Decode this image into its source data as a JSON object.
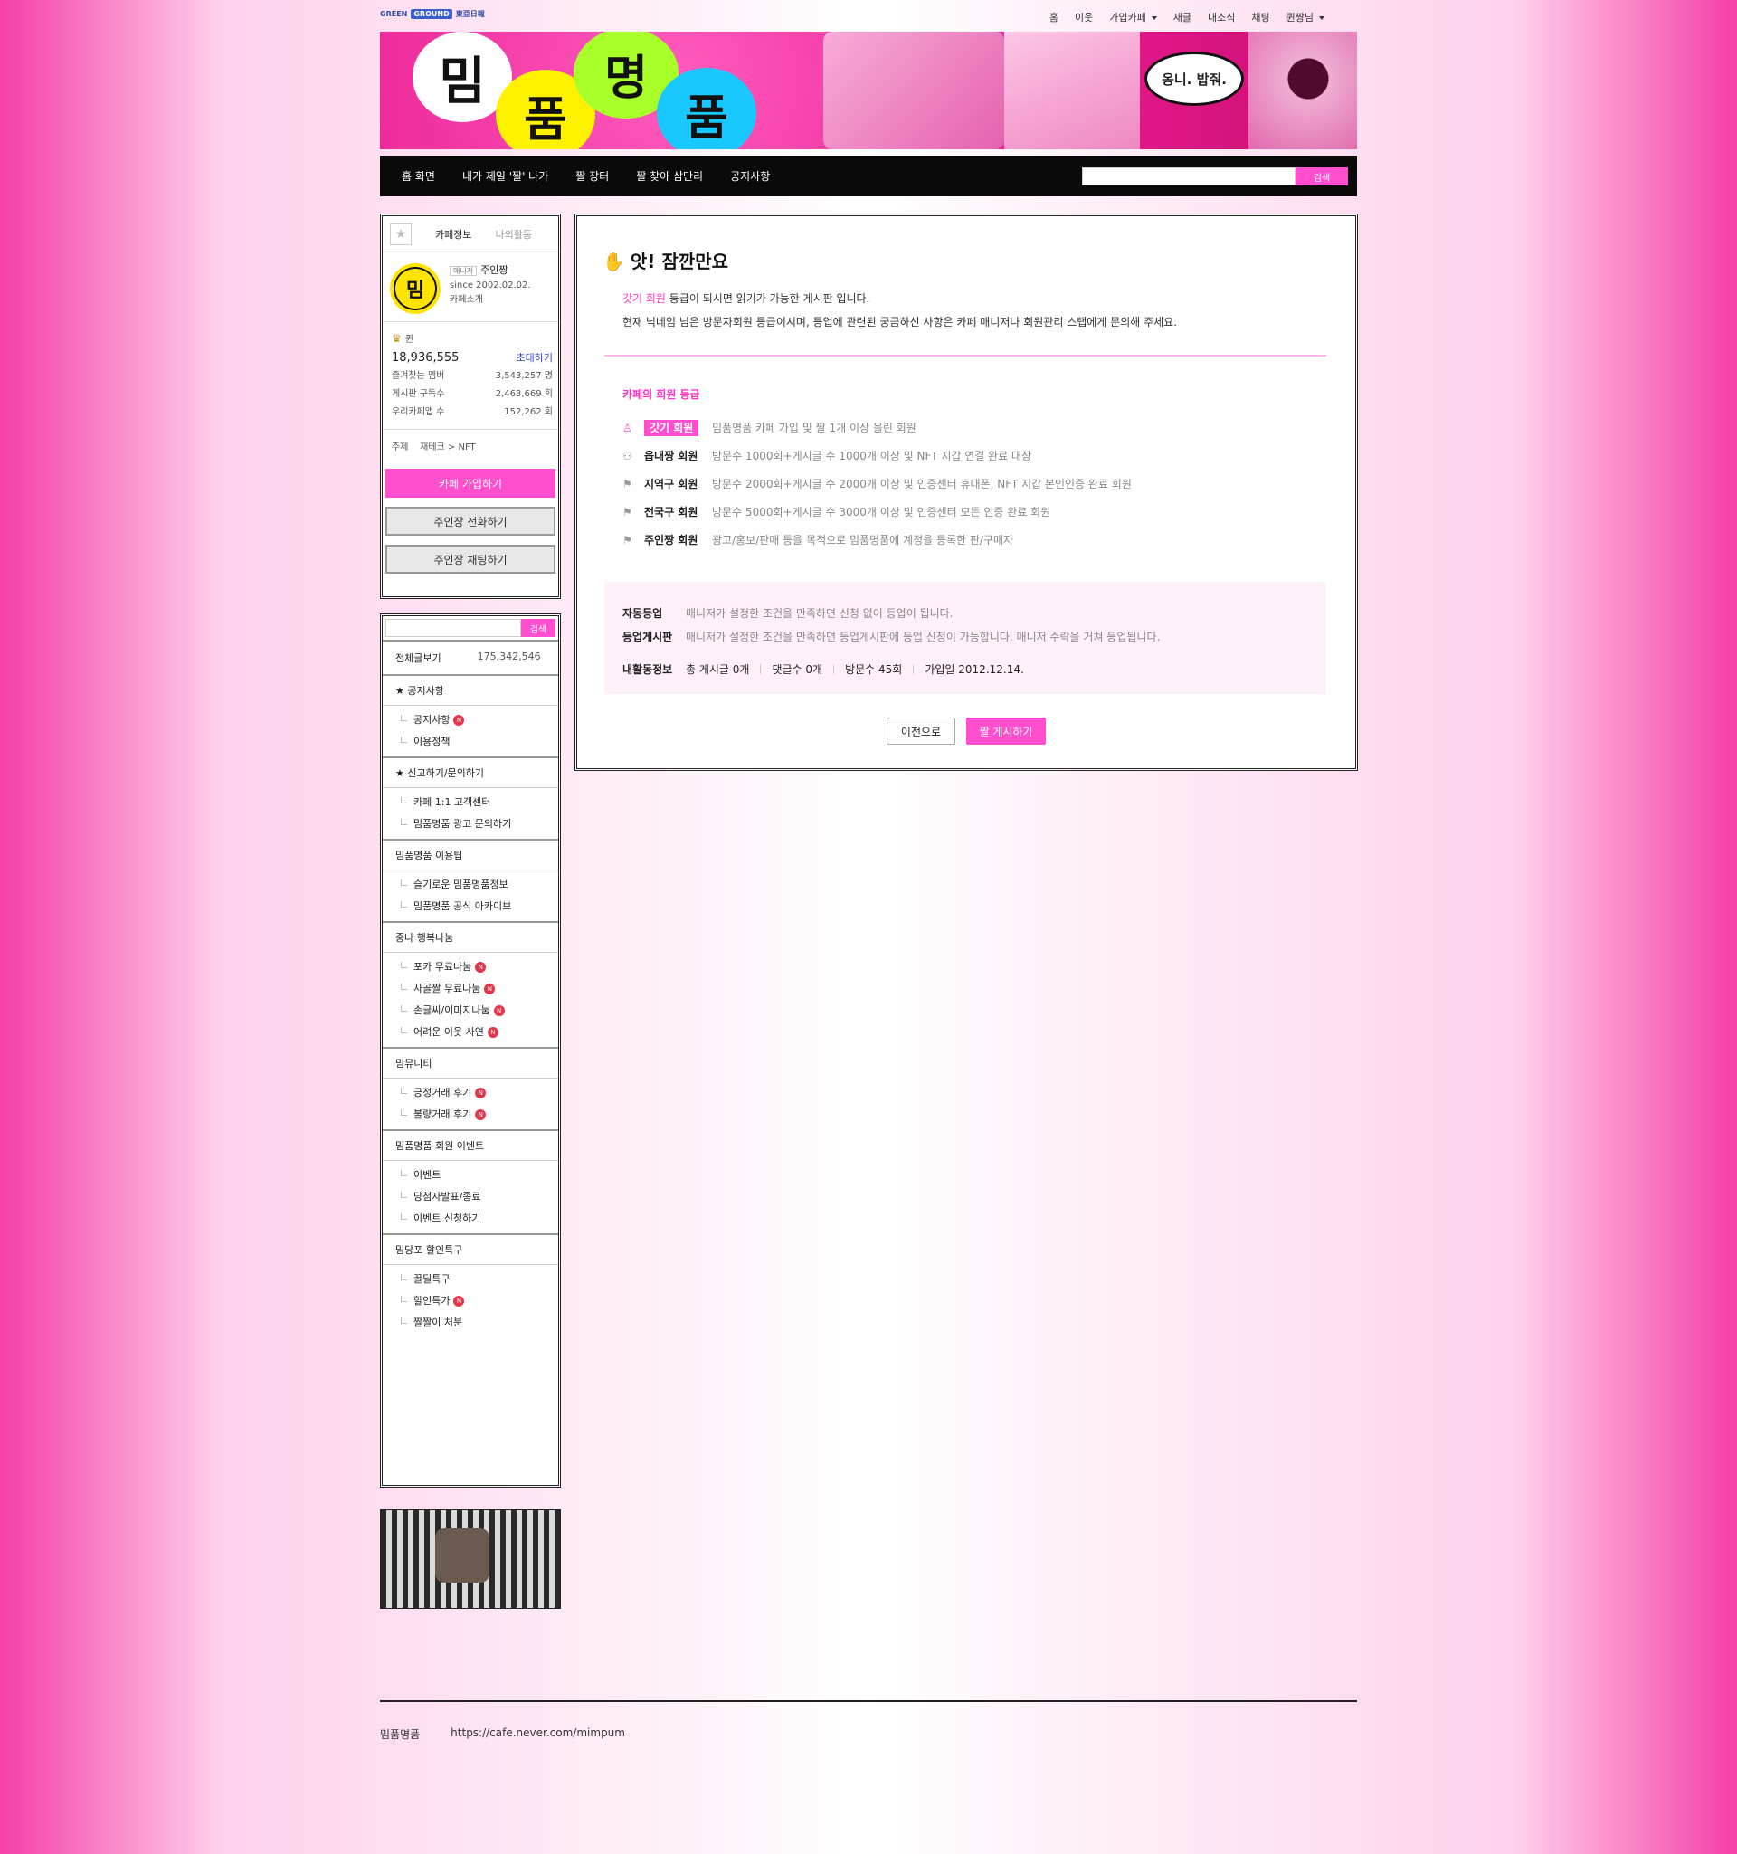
{
  "top_bar": {
    "logos": [
      "GREEN",
      "GROUND",
      "東亞日報"
    ],
    "links": [
      "홈",
      "이웃",
      "가입카페",
      "새글",
      "내소식",
      "채팅",
      "퀸짱님"
    ]
  },
  "banner": {
    "bursts": [
      "밈",
      "품",
      "명",
      "품"
    ],
    "speech": "옹니. 밥줘."
  },
  "nav": {
    "items": [
      "홈 화면",
      "내가 제일 '짤' 나가",
      "짤 장터",
      "짤 찾아 삼만리",
      "공지사항"
    ],
    "search_button": "검색"
  },
  "cafe_info": {
    "tab_info": "카페정보",
    "tab_activity": "나의활동",
    "manager_badge": "매니저",
    "manager_name": "주인짱",
    "since": "since 2002.02.02.",
    "intro": "카페소개",
    "logo_text": "밈",
    "rank": "퀸",
    "members": "18,936,555",
    "invite": "초대하기",
    "stats": [
      {
        "label": "즐겨찾는 멤버",
        "value": "3,543,257 명"
      },
      {
        "label": "게시판 구독수",
        "value": "2,463,669 회"
      },
      {
        "label": "우리카페앱 수",
        "value": "152,262 회"
      }
    ],
    "topic_label": "주제",
    "topic_value": "재테크 > NFT",
    "join_button": "카페 가입하기",
    "call_button": "주인장 전화하기",
    "chat_button": "주인장 채팅하기"
  },
  "menu": {
    "search_button": "검색",
    "total_label": "전체글보기",
    "total_count": "175,342,546",
    "sections": [
      {
        "title": "★ 공지사항",
        "items": [
          {
            "label": "공지사항",
            "new": true
          },
          {
            "label": "이용정책",
            "new": false
          }
        ]
      },
      {
        "title": "★ 신고하기/문의하기",
        "items": [
          {
            "label": "카페 1:1 고객센터",
            "new": false
          },
          {
            "label": "밈품명품 광고 문의하기",
            "new": false
          }
        ]
      },
      {
        "title": "밈품명품 이용팁",
        "items": [
          {
            "label": "슬기로운 밈품명품정보",
            "new": false
          },
          {
            "label": "밈품명품 공식 아카이브",
            "new": false
          }
        ]
      },
      {
        "title": "중나 행복나눔",
        "items": [
          {
            "label": "포카 무료나눔",
            "new": true
          },
          {
            "label": "사골짤 무료나눔",
            "new": true
          },
          {
            "label": "손글씨/이미지나눔",
            "new": true
          },
          {
            "label": "어려운 이웃 사연",
            "new": true
          }
        ]
      },
      {
        "title": "밈뮤니티",
        "items": [
          {
            "label": "긍정거래 후기",
            "new": true
          },
          {
            "label": "불량거래 후기",
            "new": true
          }
        ]
      },
      {
        "title": "밈품명품 회원 이벤트",
        "items": [
          {
            "label": "이벤트",
            "new": false
          },
          {
            "label": "당첨자발표/종료",
            "new": false
          },
          {
            "label": "이벤트 신청하기",
            "new": false
          }
        ]
      },
      {
        "title": "밈당포 할인특구",
        "items": [
          {
            "label": "꿀딜특구",
            "new": false
          },
          {
            "label": "할인특가",
            "new": true
          },
          {
            "label": "짤짤이 처분",
            "new": false
          }
        ]
      }
    ],
    "new_mark": "N"
  },
  "main": {
    "title": "앗! 잠깐만요",
    "notice_grade": "갓기 회원",
    "notice_line1": " 등급이 되시면 읽기가 가능한 게시판 입니다.",
    "notice_line2": "현재 닉네임 님은 방문자회원 등급이시며, 등업에 관련된 궁금하신 사항은 카페 매니저나 회원관리 스탭에게 문의해 주세요.",
    "grades_title": "카페의 회원 등급",
    "grades": [
      {
        "name": "갓기 회원",
        "desc": "밈품명품 카페 가입 및 짤 1개 이상 올린 회원"
      },
      {
        "name": "읍내짱 회원",
        "desc": "방문수 1000회+게시글 수 1000개 이상 및 NFT 지갑 연결 완료 대상"
      },
      {
        "name": "지역구 회원",
        "desc": "방문수 2000회+게시글 수 2000개 이상 및 인증센터 휴대폰, NFT 지갑 본인인증 완료 회원"
      },
      {
        "name": "전국구 회원",
        "desc": "방문수 5000회+게시글 수 3000개 이상 및 인증센터 모든 인증 완료 회원"
      },
      {
        "name": "주인짱 회원",
        "desc": "광고/홍보/판매 등을 목적으로 밈품명품에 계정을 등록한 판/구매자"
      }
    ],
    "auto_label": "자동등업",
    "auto_desc": "매니저가 설정한 조건을 만족하면 신청 없이 등업이 됩니다.",
    "board_label": "등업게시판",
    "board_desc": "매니저가 설정한 조건을 만족하면 등업게시판에 등업 신청이 가능합니다. 매니저 수락을 거쳐 등업됩니다.",
    "activity_label": "내활동정보",
    "activity_posts": "총 게시글 0개",
    "activity_comments": "댓글수 0개",
    "activity_visits": "방문수 45회",
    "activity_joined": "가입일 2012.12.14.",
    "prev_button": "이전으로",
    "post_button": "짤 게시하기"
  },
  "footer": {
    "name": "밈품명품",
    "url": "https://cafe.never.com/mimpum"
  },
  "colors": {
    "accent": "#ff4fcf",
    "nav": "#0a0a0a",
    "banner": "#e8188e"
  }
}
